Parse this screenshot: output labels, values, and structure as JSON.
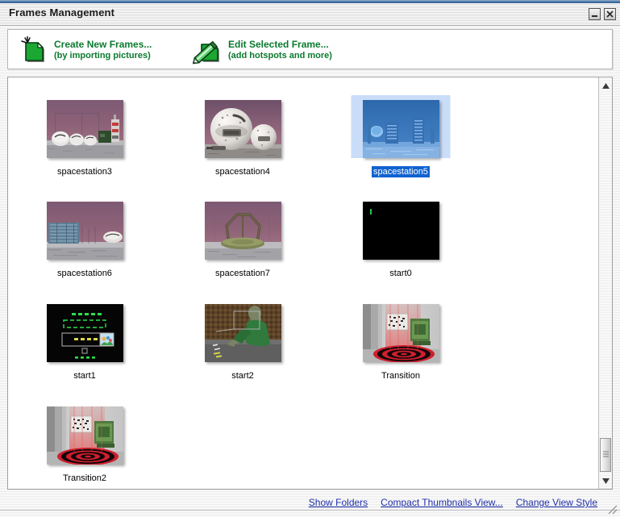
{
  "window": {
    "title": "Frames Management",
    "controls": [
      {
        "name": "minimize-button",
        "glyph": "minimize"
      },
      {
        "name": "close-button",
        "glyph": "close"
      }
    ]
  },
  "toolbar": {
    "items": [
      {
        "id": "create-new-frames",
        "icon": "new-document-icon",
        "title": "Create New Frames...",
        "subtitle": "(by importing pictures)",
        "color": "#0a7a2e"
      },
      {
        "id": "edit-selected-frame",
        "icon": "edit-pencil-document-icon",
        "title": "Edit Selected Frame...",
        "subtitle": "(add hotspots and more)",
        "color": "#0a7a2e"
      }
    ]
  },
  "frames": {
    "selected": "spacestation5",
    "items": [
      {
        "label": "spacestation3",
        "art": "spheres-field",
        "selected": false
      },
      {
        "label": "spacestation4",
        "art": "two-pods",
        "selected": false
      },
      {
        "label": "spacestation5",
        "art": "blue-city",
        "selected": true
      },
      {
        "label": "spacestation6",
        "art": "blue-building",
        "selected": false
      },
      {
        "label": "spacestation7",
        "art": "arch-structure",
        "selected": false
      },
      {
        "label": "start0",
        "art": "black-screen",
        "selected": false
      },
      {
        "label": "start1",
        "art": "green-terminal",
        "selected": false
      },
      {
        "label": "start2",
        "art": "green-figure",
        "selected": false
      },
      {
        "label": "Transition",
        "art": "red-spiral-room",
        "selected": false
      },
      {
        "label": "Transition2",
        "art": "red-spiral-room",
        "selected": false
      }
    ]
  },
  "scrollbar": {
    "orientation": "vertical",
    "thumb_position": "bottom"
  },
  "statusbar": {
    "links": [
      "Show Folders",
      "Compact Thumbnails View...",
      "Change View Style"
    ]
  },
  "colors": {
    "link": "#1f2fa8",
    "accent_green": "#0a7a2e",
    "selection_blue": "#1063d0",
    "titlebar_top": "#4c79ac"
  }
}
